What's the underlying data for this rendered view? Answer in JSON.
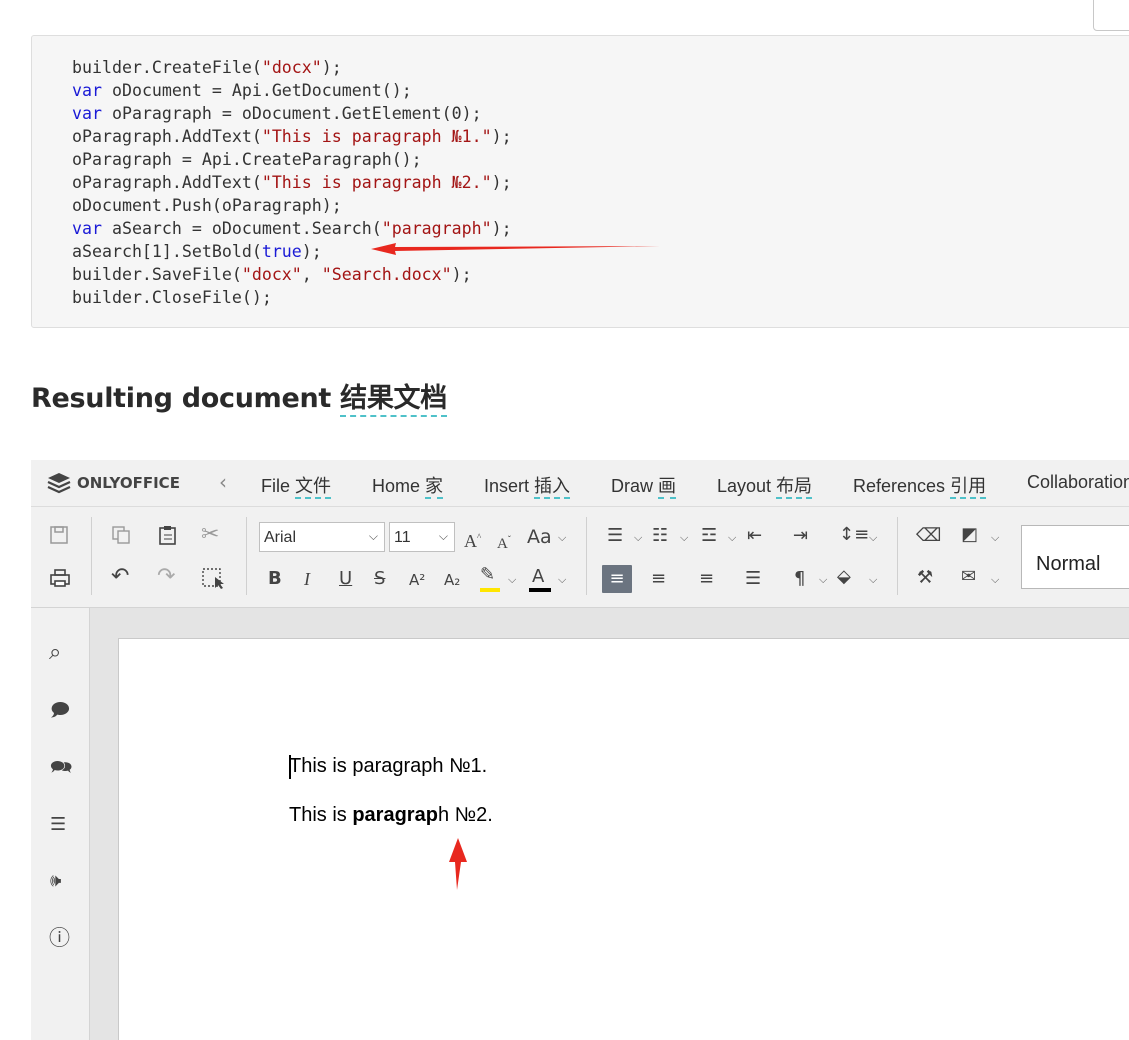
{
  "code": {
    "lines": [
      [
        {
          "t": "pl",
          "s": "builder.CreateFile("
        },
        {
          "t": "str",
          "s": "\"docx\""
        },
        {
          "t": "pl",
          "s": ");"
        }
      ],
      [
        {
          "t": "kw",
          "s": "var"
        },
        {
          "t": "pl",
          "s": " oDocument = Api.GetDocument();"
        }
      ],
      [
        {
          "t": "kw",
          "s": "var"
        },
        {
          "t": "pl",
          "s": " oParagraph = oDocument.GetElement(0);"
        }
      ],
      [
        {
          "t": "pl",
          "s": "oParagraph.AddText("
        },
        {
          "t": "str",
          "s": "\"This is paragraph №1.\""
        },
        {
          "t": "pl",
          "s": ");"
        }
      ],
      [
        {
          "t": "pl",
          "s": "oParagraph = Api.CreateParagraph();"
        }
      ],
      [
        {
          "t": "pl",
          "s": "oParagraph.AddText("
        },
        {
          "t": "str",
          "s": "\"This is paragraph №2.\""
        },
        {
          "t": "pl",
          "s": ");"
        }
      ],
      [
        {
          "t": "pl",
          "s": "oDocument.Push(oParagraph);"
        }
      ],
      [
        {
          "t": "kw",
          "s": "var"
        },
        {
          "t": "pl",
          "s": " aSearch = oDocument.Search("
        },
        {
          "t": "str",
          "s": "\"paragraph\""
        },
        {
          "t": "pl",
          "s": ");"
        }
      ],
      [
        {
          "t": "pl",
          "s": "aSearch[1].SetBold("
        },
        {
          "t": "kw",
          "s": "true"
        },
        {
          "t": "pl",
          "s": ");"
        }
      ],
      [
        {
          "t": "pl",
          "s": "builder.SaveFile("
        },
        {
          "t": "str",
          "s": "\"docx\""
        },
        {
          "t": "pl",
          "s": ", "
        },
        {
          "t": "str",
          "s": "\"Search.docx\""
        },
        {
          "t": "pl",
          "s": ");"
        }
      ],
      [
        {
          "t": "pl",
          "s": "builder.CloseFile();"
        }
      ]
    ]
  },
  "heading": {
    "text": "Resulting document",
    "translation": "结果文档"
  },
  "editor": {
    "logo": "ONLYOFFICE",
    "tabs": [
      {
        "label": "File",
        "translation": "文件"
      },
      {
        "label": "Home",
        "translation": "家"
      },
      {
        "label": "Insert",
        "translation": "插入"
      },
      {
        "label": "Draw",
        "translation": "画"
      },
      {
        "label": "Layout",
        "translation": "布局"
      },
      {
        "label": "References",
        "translation": "引用"
      },
      {
        "label": "Collaboration",
        "translation": ""
      }
    ],
    "font_name": "Arial",
    "font_size": "11",
    "style": "Normal",
    "toolbar": {
      "bold": "B",
      "italic": "I",
      "underline": "U",
      "strike": "S",
      "superscript": "A²",
      "subscript": "A₂",
      "case": "Aa",
      "grow": "A",
      "shrink": "A",
      "font_color": "A"
    },
    "highlight_color": "#ffe600",
    "font_color": "#000000",
    "document": {
      "p1": "This is paragraph №1.",
      "p2_before": "This is ",
      "p2_bold": "paragrap",
      "p2_after": "h №2."
    }
  },
  "annotation_color": "#e8281f"
}
